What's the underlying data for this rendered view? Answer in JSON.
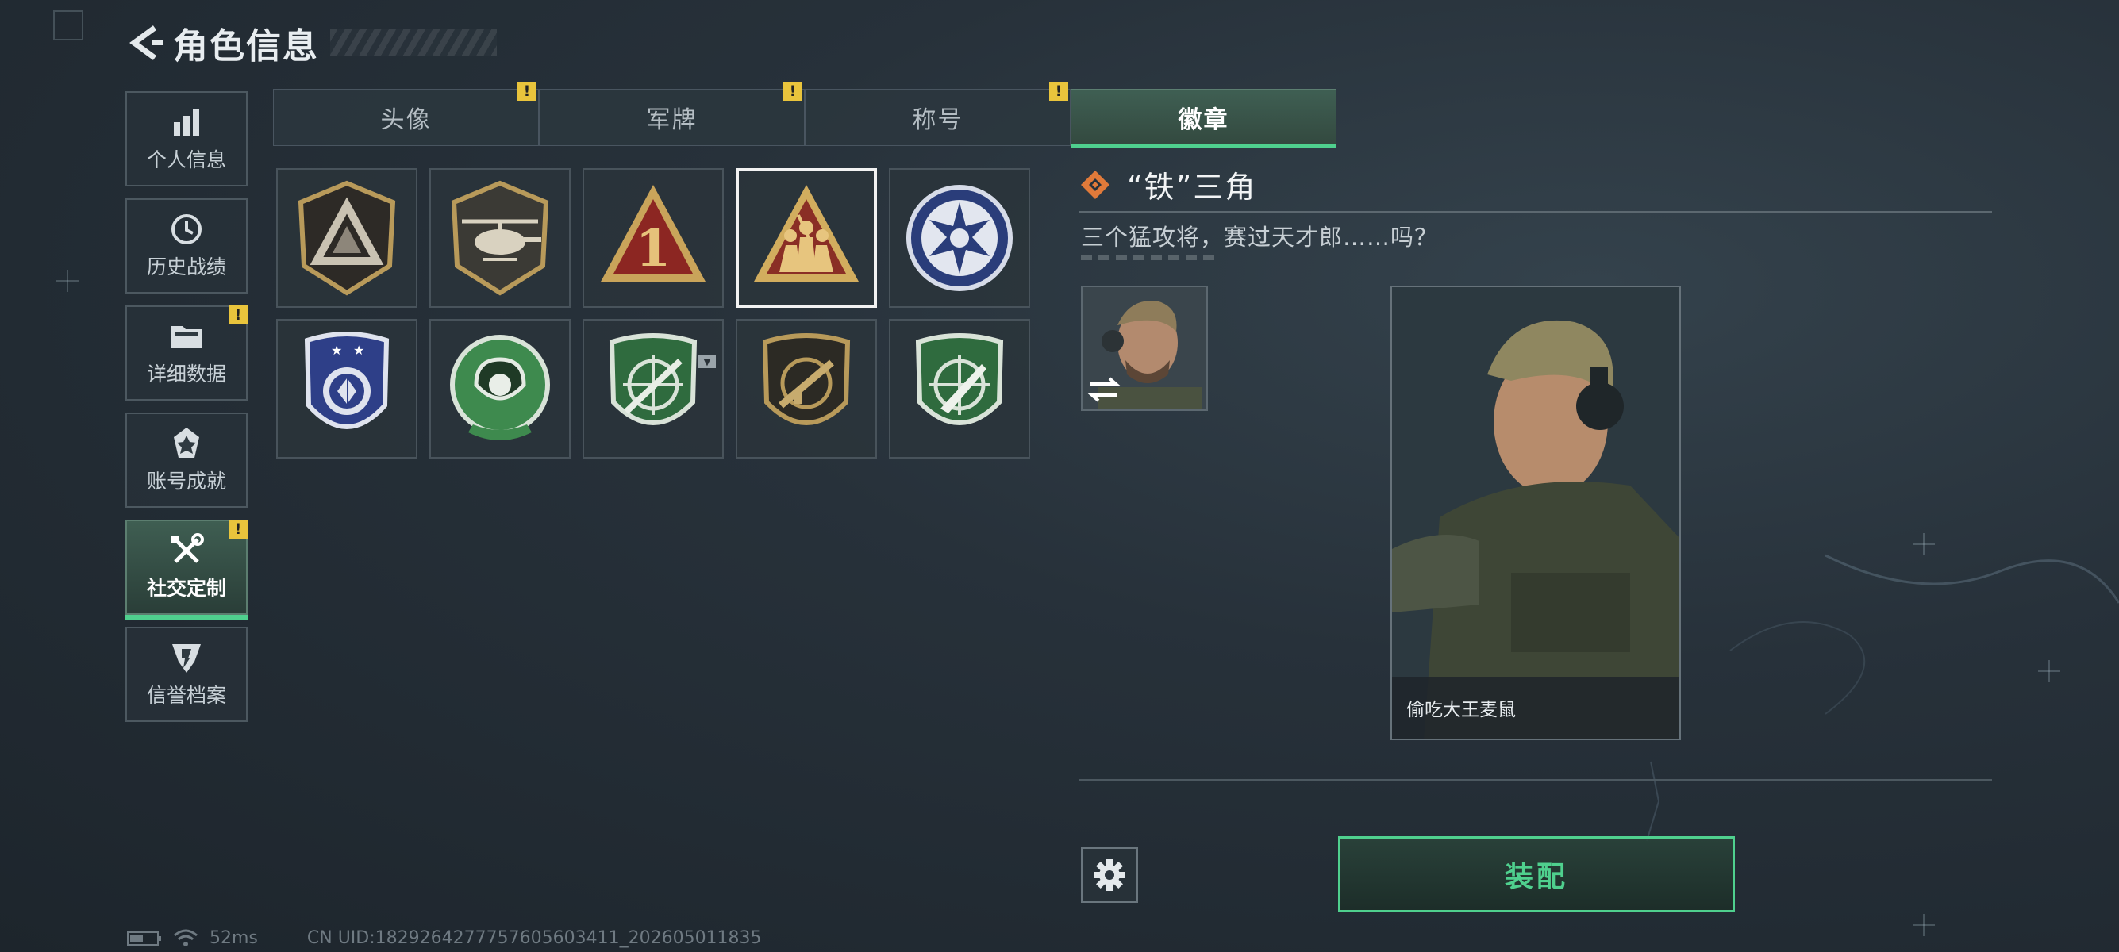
{
  "header": {
    "title": "角色信息",
    "back_icon": "back-arrow-icon"
  },
  "sidebar": {
    "items": [
      {
        "label": "个人信息",
        "icon": "bar-chart-icon",
        "alert": false,
        "active": false
      },
      {
        "label": "历史战绩",
        "icon": "clock-icon",
        "alert": false,
        "active": false
      },
      {
        "label": "详细数据",
        "icon": "folder-icon",
        "alert": true,
        "active": false
      },
      {
        "label": "账号成就",
        "icon": "medal-icon",
        "alert": false,
        "active": false
      },
      {
        "label": "社交定制",
        "icon": "tools-icon",
        "alert": true,
        "active": true
      },
      {
        "label": "信誉档案",
        "icon": "shield-icon",
        "alert": false,
        "active": false
      }
    ],
    "alert_mark": "!"
  },
  "tabs": [
    {
      "label": "头像",
      "alert": true,
      "active": false
    },
    {
      "label": "军牌",
      "alert": true,
      "active": false
    },
    {
      "label": "称号",
      "alert": true,
      "active": false
    },
    {
      "label": "徽章",
      "alert": false,
      "active": true
    }
  ],
  "badges": [
    {
      "icon": "triangle-shield-badge-icon",
      "selected": false
    },
    {
      "icon": "helicopter-badge-icon",
      "selected": false
    },
    {
      "icon": "number-one-triangle-badge-icon",
      "selected": false
    },
    {
      "icon": "iron-triangle-soldiers-badge-icon",
      "selected": true
    },
    {
      "icon": "star-seal-badge-icon",
      "selected": false
    },
    {
      "icon": "police-shield-badge-icon",
      "selected": false
    },
    {
      "icon": "pearl-shell-badge-icon",
      "selected": false
    },
    {
      "icon": "sniper-rifle-badge-icon",
      "selected": false
    },
    {
      "icon": "rifle-crosshair-badge-icon",
      "selected": false
    },
    {
      "icon": "knife-crosshair-badge-icon",
      "selected": false
    }
  ],
  "detail": {
    "title": "“铁”三角",
    "description": "三个猛攻将，赛过天才郎……吗？",
    "character_name": "偷吃大王麦鼠"
  },
  "actions": {
    "equip_label": "装配"
  },
  "status": {
    "ping": "52ms",
    "uid": "CN UID:1829264277757605603411_202605011835"
  },
  "colors": {
    "accent": "#4fd08e",
    "alert": "#e9c43c",
    "diamond": "#e07a3a"
  }
}
